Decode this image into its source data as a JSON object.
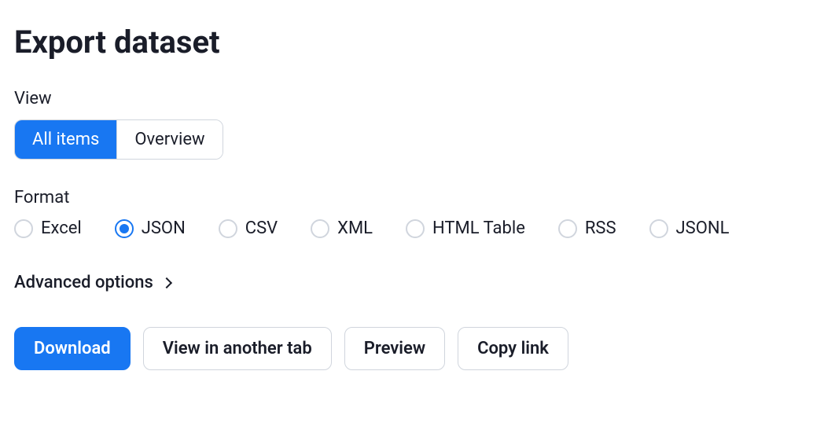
{
  "title": "Export dataset",
  "view": {
    "label": "View",
    "options": [
      {
        "label": "All items",
        "active": true
      },
      {
        "label": "Overview",
        "active": false
      }
    ]
  },
  "format": {
    "label": "Format",
    "options": [
      {
        "label": "Excel",
        "selected": false
      },
      {
        "label": "JSON",
        "selected": true
      },
      {
        "label": "CSV",
        "selected": false
      },
      {
        "label": "XML",
        "selected": false
      },
      {
        "label": "HTML Table",
        "selected": false
      },
      {
        "label": "RSS",
        "selected": false
      },
      {
        "label": "JSONL",
        "selected": false
      }
    ]
  },
  "advanced_label": "Advanced options",
  "actions": {
    "download": "Download",
    "view_tab": "View in another tab",
    "preview": "Preview",
    "copy_link": "Copy link"
  }
}
